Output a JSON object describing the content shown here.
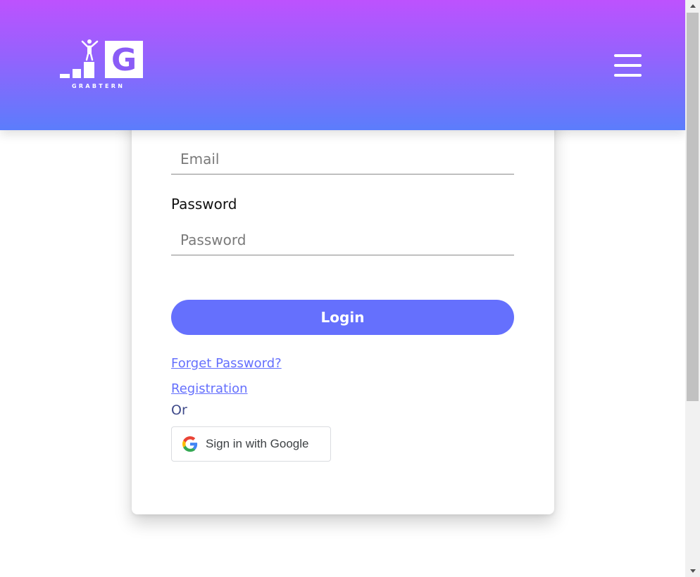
{
  "header": {
    "brand_name": "GRABTERN",
    "logo_letter": "G",
    "menu_icon": "hamburger-menu-icon",
    "gradient_top": "#bd52fe",
    "gradient_bottom": "#5b7dfc"
  },
  "form": {
    "email_placeholder": "Email",
    "email_value": "",
    "password_label": "Password",
    "password_placeholder": "Password",
    "password_value": "",
    "login_label": "Login",
    "forgot_password_link": "Forget Password?",
    "registration_link": "Registration",
    "or_text": "Or",
    "google_button_label": "Sign in with Google",
    "google_icon": "google-g-icon"
  },
  "colors": {
    "accent": "#6570fd",
    "or_text": "#3f4a8a"
  }
}
